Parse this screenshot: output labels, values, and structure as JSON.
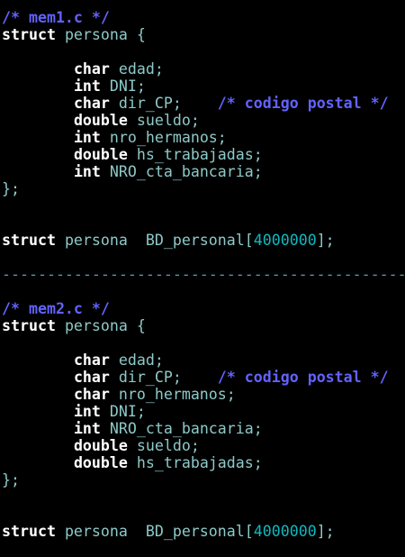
{
  "colors": {
    "background": "#000000",
    "keyword": "#ffffff",
    "comment": "#6262ff",
    "identifier": "#8ec9c9",
    "number": "#10b8c0",
    "separator": "#4f9aa8"
  },
  "lines": [
    [
      [
        "cm",
        "/* mem1.c */"
      ]
    ],
    [
      [
        "kw",
        "struct"
      ],
      [
        "id",
        " persona {"
      ]
    ],
    [],
    [
      [
        "id",
        "        "
      ],
      [
        "kw",
        "char"
      ],
      [
        "id",
        " edad;"
      ]
    ],
    [
      [
        "id",
        "        "
      ],
      [
        "kw",
        "int"
      ],
      [
        "id",
        " DNI;"
      ]
    ],
    [
      [
        "id",
        "        "
      ],
      [
        "kw",
        "char"
      ],
      [
        "id",
        " dir_CP;    "
      ],
      [
        "cm",
        "/* codigo postal */"
      ]
    ],
    [
      [
        "id",
        "        "
      ],
      [
        "kw",
        "double"
      ],
      [
        "id",
        " sueldo;"
      ]
    ],
    [
      [
        "id",
        "        "
      ],
      [
        "kw",
        "int"
      ],
      [
        "id",
        " nro_hermanos;"
      ]
    ],
    [
      [
        "id",
        "        "
      ],
      [
        "kw",
        "double"
      ],
      [
        "id",
        " hs_trabajadas;"
      ]
    ],
    [
      [
        "id",
        "        "
      ],
      [
        "kw",
        "int"
      ],
      [
        "id",
        " NRO_cta_bancaria;"
      ]
    ],
    [
      [
        "id",
        "};"
      ]
    ],
    [],
    [],
    [
      [
        "kw",
        "struct"
      ],
      [
        "id",
        " persona  BD_personal["
      ],
      [
        "num",
        "4000000"
      ],
      [
        "id",
        "];"
      ]
    ],
    [],
    [
      [
        "sep",
        "---------------------------------------------"
      ]
    ],
    [],
    [
      [
        "cm",
        "/* mem2.c */"
      ]
    ],
    [
      [
        "kw",
        "struct"
      ],
      [
        "id",
        " persona {"
      ]
    ],
    [],
    [
      [
        "id",
        "        "
      ],
      [
        "kw",
        "char"
      ],
      [
        "id",
        " edad;"
      ]
    ],
    [
      [
        "id",
        "        "
      ],
      [
        "kw",
        "char"
      ],
      [
        "id",
        " dir_CP;    "
      ],
      [
        "cm",
        "/* codigo postal */"
      ]
    ],
    [
      [
        "id",
        "        "
      ],
      [
        "kw",
        "char"
      ],
      [
        "id",
        " nro_hermanos;"
      ]
    ],
    [
      [
        "id",
        "        "
      ],
      [
        "kw",
        "int"
      ],
      [
        "id",
        " DNI;"
      ]
    ],
    [
      [
        "id",
        "        "
      ],
      [
        "kw",
        "int"
      ],
      [
        "id",
        " NRO_cta_bancaria;"
      ]
    ],
    [
      [
        "id",
        "        "
      ],
      [
        "kw",
        "double"
      ],
      [
        "id",
        " sueldo;"
      ]
    ],
    [
      [
        "id",
        "        "
      ],
      [
        "kw",
        "double"
      ],
      [
        "id",
        " hs_trabajadas;"
      ]
    ],
    [
      [
        "id",
        "};"
      ]
    ],
    [],
    [],
    [
      [
        "kw",
        "struct"
      ],
      [
        "id",
        " persona  BD_personal["
      ],
      [
        "num",
        "4000000"
      ],
      [
        "id",
        "];"
      ]
    ]
  ]
}
